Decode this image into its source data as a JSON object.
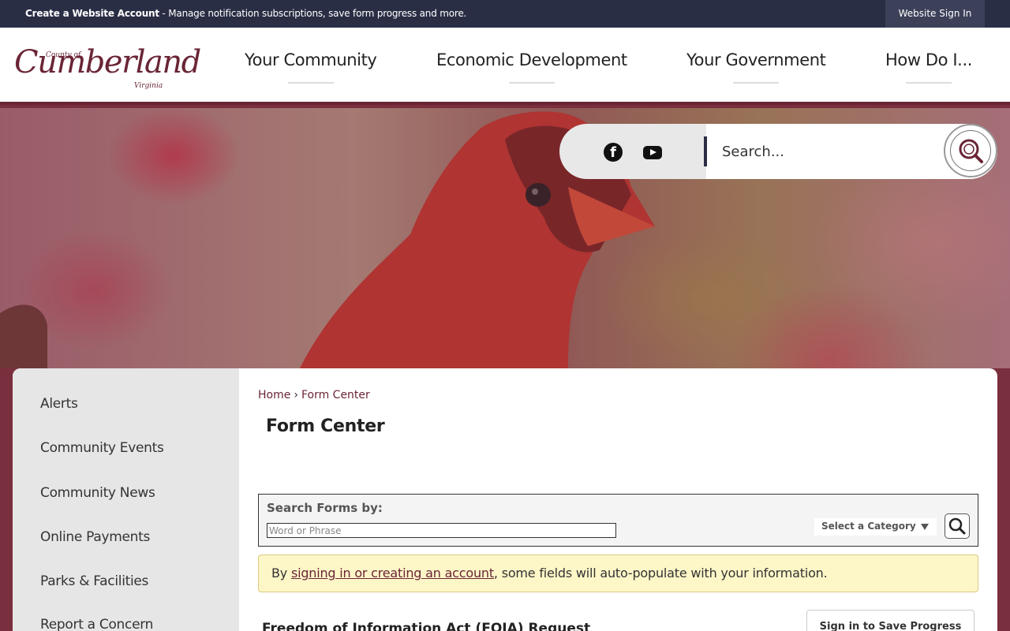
{
  "topbar": {
    "create_label": "Create a Website Account",
    "create_desc": " - Manage notification subscriptions, save form progress and more.",
    "signin_label": "Website Sign In"
  },
  "logo": {
    "county_of": "County of",
    "name": "Cumberland",
    "state": "Virginia"
  },
  "nav": {
    "items": [
      {
        "label": "Your Community"
      },
      {
        "label": "Economic Development"
      },
      {
        "label": "Your Government"
      },
      {
        "label": "How Do I..."
      }
    ]
  },
  "search": {
    "placeholder": "Search..."
  },
  "sidebar": {
    "items": [
      {
        "label": "Alerts"
      },
      {
        "label": "Community Events"
      },
      {
        "label": "Community News"
      },
      {
        "label": "Online Payments"
      },
      {
        "label": "Parks & Facilities"
      },
      {
        "label": "Report a Concern"
      }
    ]
  },
  "breadcrumb": {
    "home": "Home",
    "separator": "›",
    "current": "Form Center"
  },
  "page": {
    "title": "Form Center"
  },
  "form_search": {
    "label": "Search Forms by:",
    "placeholder": "Word or Phrase",
    "category_label": "Select a Category"
  },
  "notice": {
    "before": "By ",
    "link": "signing in or creating an account",
    "after": ", some fields will auto-populate with your information."
  },
  "form": {
    "title": "Freedom of Information Act (FOIA) Request",
    "save_label": "Sign in to Save Progress"
  },
  "colors": {
    "brand": "#6a2535",
    "topbar": "#2a2e45",
    "notice_bg": "#fdf6c7"
  }
}
